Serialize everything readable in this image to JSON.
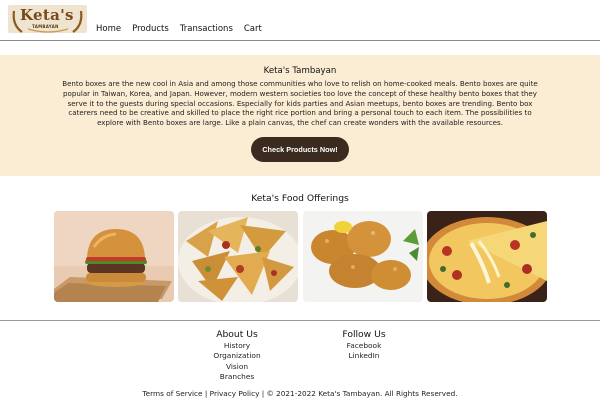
{
  "brand": {
    "logo_text": "Keta's",
    "logo_sub": "TAMBAYAN"
  },
  "nav": {
    "items": [
      "Home",
      "Products",
      "Transactions",
      "Cart"
    ]
  },
  "hero": {
    "title": "Keta's Tambayan",
    "text": "Bento boxes are the new cool in Asia and among those communities who love to relish on home-cooked meals. Bento boxes are quite popular in Taiwan, Korea, and Japan. However, modern western societies too love the concept of these healthy bento boxes that they serve it to the guests during special occasions. Especially for kids parties and Asian meetups, bento boxes are trending. Bento box caterers need to be creative and skilled to place the right rice portion and bring a personal touch to each item. The possibilities to explore with Bento boxes are large. Like a plain canvas, the chef can create wonders with the available resources.",
    "cta_label": "Check Products Now!"
  },
  "offerings": {
    "title": "Keta's Food Offerings",
    "items": [
      "burger-image",
      "nachos-image",
      "fried-chicken-image",
      "pizza-image"
    ]
  },
  "footer": {
    "about": {
      "heading": "About Us",
      "links": [
        "History",
        "Organization",
        "Vision",
        "Branches"
      ]
    },
    "follow": {
      "heading": "Follow Us",
      "links": [
        "Facebook",
        "LinkedIn"
      ]
    },
    "terms": "Terms of Service",
    "privacy": "Privacy Policy",
    "copyright": "© 2021-2022 Keta's Tambayan. All Rights Reserved."
  },
  "colors": {
    "hero_bg": "#fbecd4",
    "cta_bg": "#3b2a1f",
    "logo_brown": "#7a4a1b"
  }
}
